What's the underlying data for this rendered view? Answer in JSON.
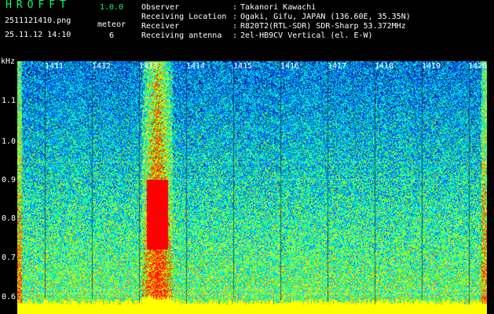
{
  "header": {
    "app_title": "HROFFT",
    "app_version": "1.0.0",
    "file_name": "2511121410.png",
    "timestamp": "25.11.12 14:10",
    "meteor_label": "meteor",
    "meteor_count": "6"
  },
  "info": [
    {
      "label": "Observer",
      "value": "Takanori Kawachi"
    },
    {
      "label": "Receiving Location",
      "value": "Ogaki, Gifu, JAPAN (136.60E, 35.35N)"
    },
    {
      "label": "Receiver",
      "value": "R820T2(RTL-SDR) SDR-Sharp 53.372MHz"
    },
    {
      "label": "Receiving antenna",
      "value": "2el-HB9CV Vertical (el. E-W)"
    }
  ],
  "colon": ":",
  "y_axis": {
    "unit": "kHz",
    "ticks": [
      "1.1",
      "1.0",
      "0.9",
      "0.8",
      "0.7",
      "0.6"
    ]
  },
  "x_axis": {
    "ticks": [
      "1411",
      "1412",
      "1413",
      "1414",
      "1415",
      "1416",
      "1417",
      "1418",
      "1419",
      "1420"
    ]
  },
  "colors": {
    "background": "#000000",
    "title": "#00ff66",
    "noise_floor": "#00005a",
    "signal_low": "#0050ff",
    "signal_mid": "#00ffff",
    "signal_high": "#ffff00",
    "signal_peak": "#ff0000",
    "baseline": "#ffff00"
  }
}
